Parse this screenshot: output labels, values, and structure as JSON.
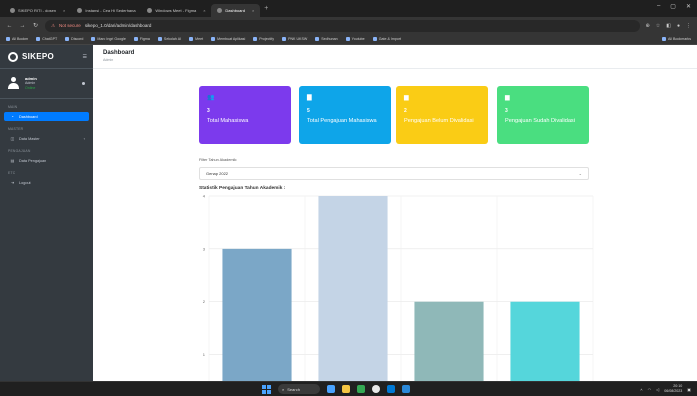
{
  "browser": {
    "tabs": [
      {
        "label": "SIKEPO RITI - dosen",
        "active": false
      },
      {
        "label": "Instansi - Cea Hi Sederhana",
        "active": false
      },
      {
        "label": "Windows Meet - Figma",
        "active": false
      },
      {
        "label": "Dashboard",
        "active": true
      }
    ],
    "url_warning": "Not secure",
    "url": "sikepo_1.0/dari/admin/dashboard",
    "bookmarks": [
      "All Bookm",
      "ChatGPT",
      "Discord",
      "Marc Ingri Google",
      "Figma",
      "Sekolah AI",
      "Meet",
      "Membuat Aplikasi",
      "Projectify",
      "PNK UKSW",
      "Sedhunan",
      "Youtube",
      "Gate & Import"
    ],
    "bookmarks_all": "All Bookmarks"
  },
  "sidebar": {
    "brand": "SIKEPO",
    "user": {
      "name": "admin",
      "role": "Admin",
      "status": "Online"
    },
    "sections": [
      {
        "header": "MAIN",
        "items": [
          {
            "label": "Dashboard",
            "icon": "speedometer-icon",
            "active": true
          }
        ]
      },
      {
        "header": "MASTER",
        "items": [
          {
            "label": "Data Master",
            "icon": "database-icon",
            "active": false
          }
        ]
      },
      {
        "header": "PENGAJUAN",
        "items": [
          {
            "label": "Data Pengajuan",
            "icon": "file-icon",
            "active": false
          }
        ]
      },
      {
        "header": "ETC",
        "items": [
          {
            "label": "Logout",
            "icon": "logout-icon",
            "active": false
          }
        ]
      }
    ]
  },
  "header": {
    "title": "Dashboard",
    "subtitle": "Admin"
  },
  "cards": [
    {
      "value": "3",
      "label": "Total Mahasiswa",
      "color": "#7c3aed",
      "icon": "users-icon"
    },
    {
      "value": "5",
      "label": "Total Pengajuan Mahasiswa",
      "color": "#0ea5e9",
      "icon": "folder-icon"
    },
    {
      "value": "2",
      "label": "Pengajuan Belum Divalidasi",
      "color": "#facc15",
      "icon": "clipboard-icon"
    },
    {
      "value": "3",
      "label": "Pengajuan Sudah Divalidasi",
      "color": "#4ade80",
      "icon": "check-icon"
    }
  ],
  "filter": {
    "label": "Filter Tahun Akademik:",
    "selected": "Genap 2022"
  },
  "chart_data": {
    "type": "bar",
    "title": "Statistik Pengajuan Tahun Akademik :",
    "categories": [
      "",
      "",
      "",
      ""
    ],
    "values": [
      3,
      4,
      2,
      2
    ],
    "colors": [
      "#7ba7c7",
      "#c4d4e6",
      "#8fb8b8",
      "#55d6db"
    ],
    "ylim": [
      0.5,
      4
    ],
    "yticks": [
      1,
      2,
      3,
      4
    ],
    "grid": true
  },
  "taskbar": {
    "search": "Search",
    "time": "20:10",
    "date": "06/08/2023"
  }
}
